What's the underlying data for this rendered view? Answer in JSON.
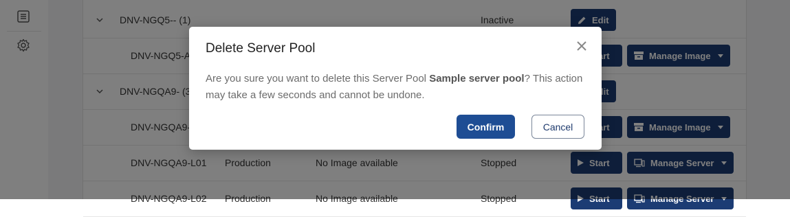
{
  "sidebar": {
    "icons": [
      "list-icon",
      "gear-icon"
    ]
  },
  "rows": [
    {
      "name": "DNV-NGQ5-- (1)",
      "environment": "",
      "image": "",
      "status": "Inactive",
      "group": true
    },
    {
      "name": "DNV-NGQ5-AS",
      "environment": "",
      "image": "",
      "status": "",
      "group": false
    },
    {
      "name": "DNV-NGQA9- (3)",
      "environment": "",
      "image": "",
      "status": "",
      "group": true
    },
    {
      "name": "DNV-NGQA9-L00",
      "environment": "",
      "image": "",
      "status": "",
      "group": false
    },
    {
      "name": "DNV-NGQA9-L01",
      "environment": "Production",
      "image": "No Image available",
      "status": "Stopped",
      "group": false
    },
    {
      "name": "DNV-NGQA9-L02",
      "environment": "Production",
      "image": "No Image available",
      "status": "Stopped",
      "group": false
    }
  ],
  "buttons": {
    "edit": "Edit",
    "start": "Start",
    "manage_image": "Manage Image",
    "manage_server": "Manage Server"
  },
  "dialog": {
    "title": "Delete Server Pool",
    "body_prefix": "Are you sure you want to delete this Server Pool ",
    "pool_name": "Sample server pool",
    "body_suffix": "? This action may take a few seconds and cannot be undone.",
    "confirm": "Confirm",
    "cancel": "Cancel"
  },
  "colors": {
    "primary": "#1c3c74",
    "confirm": "#1e4d94",
    "overlay": "rgba(0,0,0,0.5)"
  }
}
